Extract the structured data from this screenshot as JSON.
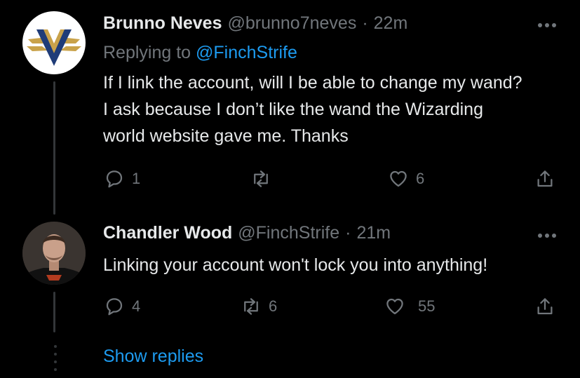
{
  "tweets": [
    {
      "display_name": "Brunno Neves",
      "handle": "@brunno7neves",
      "separator": "·",
      "time": "22m",
      "reply_prefix": "Replying to",
      "reply_to": "@FinchStrife",
      "text": "If I link the account, will I be able to change my wand? I ask because I don’t like the wand the Wizarding world website gave me. Thanks",
      "replies": "1",
      "retweets": "",
      "likes": "6"
    },
    {
      "display_name": "Chandler Wood",
      "handle": "@FinchStrife",
      "separator": "·",
      "time": "21m",
      "text": "Linking your account won't lock you into anything!",
      "replies": "4",
      "retweets": "6",
      "likes": "55"
    }
  ],
  "show_replies_label": "Show replies",
  "colors": {
    "background": "#000000",
    "text": "#e7e9ea",
    "muted": "#71767b",
    "link": "#1d9bf0",
    "thread_line": "#333639"
  }
}
